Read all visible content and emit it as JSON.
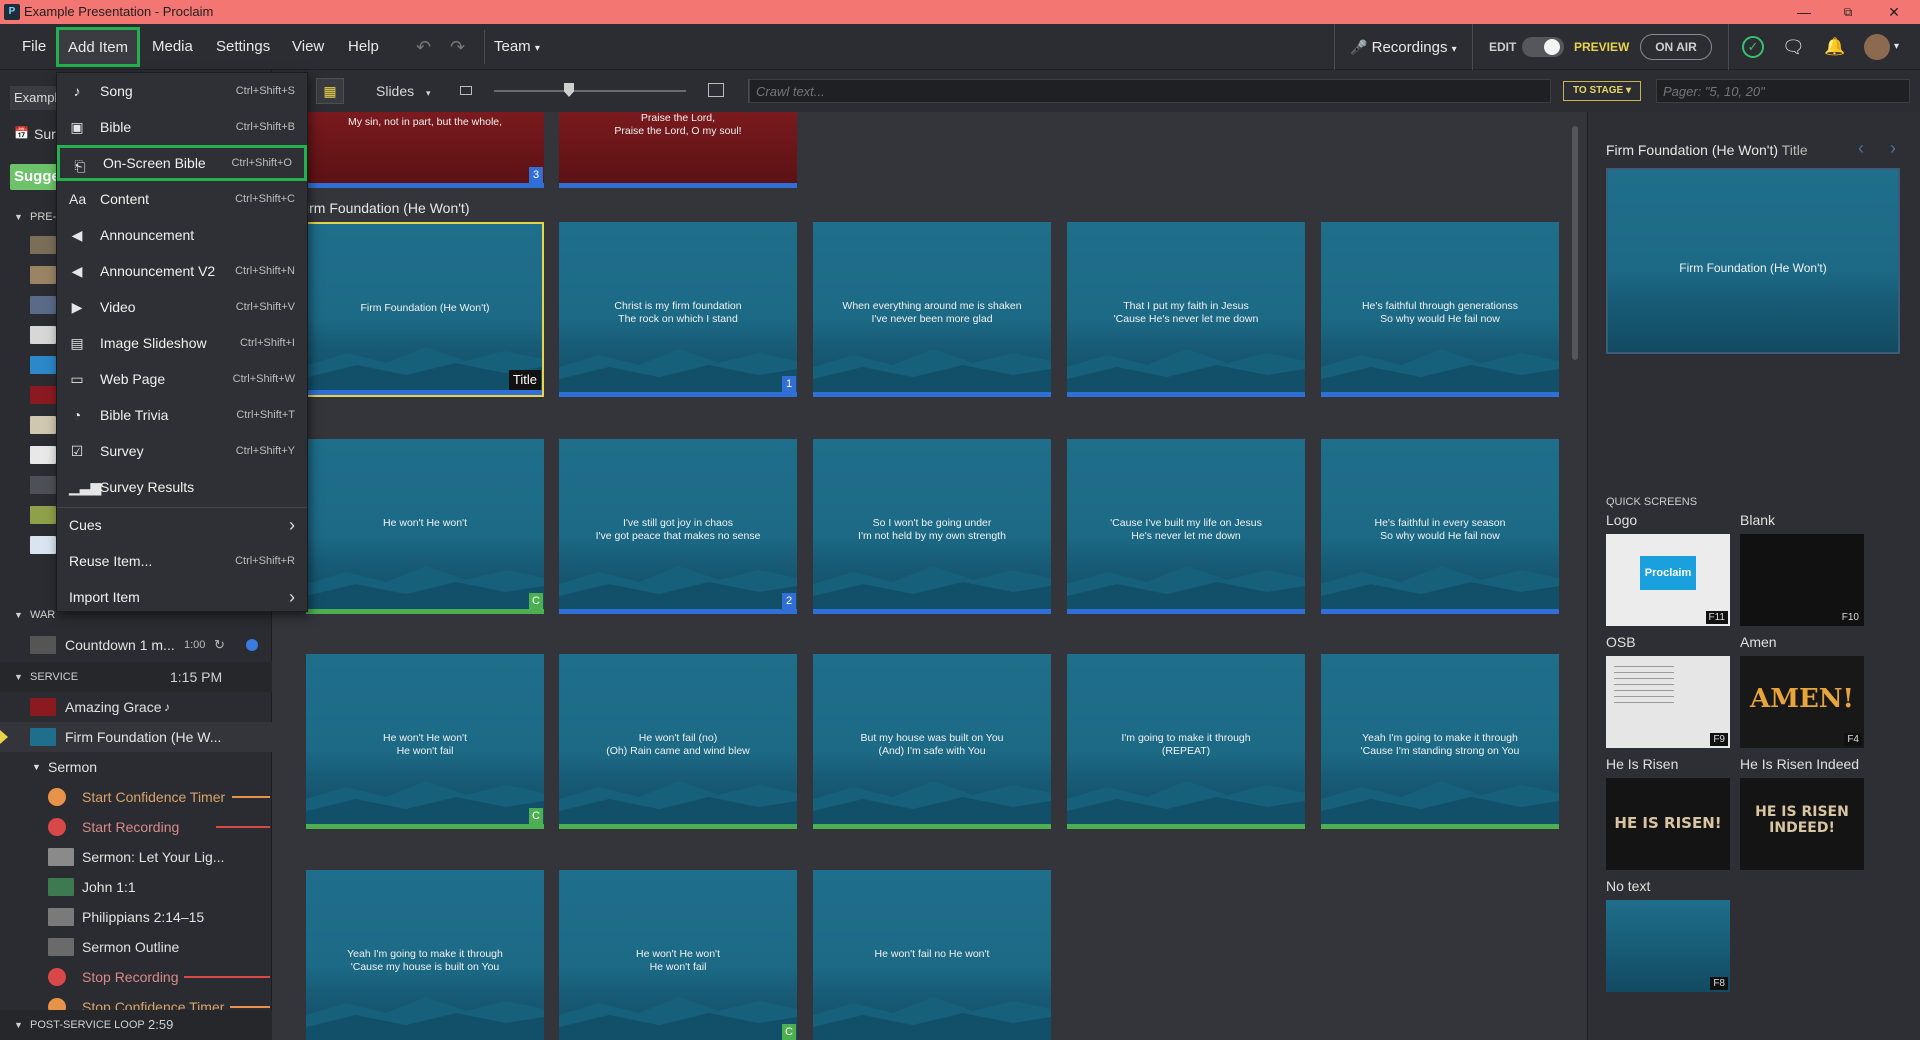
{
  "window": {
    "title": "Example Presentation - Proclaim",
    "app_icon": "proclaim-icon"
  },
  "menubar": {
    "items": [
      "File",
      "Add Item",
      "Media",
      "Settings",
      "View",
      "Help"
    ],
    "team": "Team",
    "recordings": "Recordings",
    "edit": "EDIT",
    "preview": "PREVIEW",
    "on_air": "ON AIR"
  },
  "dropdown": {
    "items": [
      {
        "label": "Song",
        "shortcut": "Ctrl+Shift+S",
        "icon": "music-note-icon"
      },
      {
        "label": "Bible",
        "shortcut": "Ctrl+Shift+B",
        "icon": "bible-icon"
      },
      {
        "label": "On-Screen Bible",
        "shortcut": "Ctrl+Shift+O",
        "icon": "onscreen-bible-icon"
      },
      {
        "label": "Content",
        "shortcut": "Ctrl+Shift+C",
        "icon": "text-content-icon"
      },
      {
        "label": "Announcement",
        "shortcut": "",
        "icon": "megaphone-icon"
      },
      {
        "label": "Announcement V2",
        "shortcut": "Ctrl+Shift+N",
        "icon": "megaphone-icon"
      },
      {
        "label": "Video",
        "shortcut": "Ctrl+Shift+V",
        "icon": "video-camera-icon"
      },
      {
        "label": "Image Slideshow",
        "shortcut": "Ctrl+Shift+I",
        "icon": "images-icon"
      },
      {
        "label": "Web Page",
        "shortcut": "Ctrl+Shift+W",
        "icon": "web-page-icon"
      },
      {
        "label": "Bible Trivia",
        "shortcut": "Ctrl+Shift+T",
        "icon": "pie-chart-icon"
      },
      {
        "label": "Survey",
        "shortcut": "Ctrl+Shift+Y",
        "icon": "checkbox-icon"
      },
      {
        "label": "Survey Results",
        "shortcut": "",
        "icon": "bar-chart-icon"
      },
      {
        "label": "Cues",
        "shortcut": "",
        "icon": ""
      },
      {
        "label": "Reuse Item...",
        "shortcut": "Ctrl+Shift+R",
        "icon": ""
      },
      {
        "label": "Import Item",
        "shortcut": "",
        "icon": ""
      }
    ]
  },
  "toolbar": {
    "slides": "Slides",
    "crawl_placeholder": "Crawl text...",
    "to_stage": "TO STAGE",
    "pager_placeholder": "Pager: \"5, 10, 20\""
  },
  "sidebar": {
    "partial_tab": "Exampl",
    "partial_sun": "Sur",
    "partial_suggest": "Sugge",
    "sections": {
      "pre": "PRE-",
      "war": "WAR",
      "service": "SERVICE",
      "service_time": "1:15 PM",
      "post": "POST-SERVICE LOOP",
      "post_time": "2:59"
    },
    "countdown": {
      "label": "Countdown 1 m...",
      "time": "1:00"
    },
    "service_items": [
      {
        "label": "Amazing Grace"
      },
      {
        "label": "Firm Foundation (He W..."
      },
      {
        "label": "Sermon"
      },
      {
        "label": "Start Confidence Timer"
      },
      {
        "label": "Start Recording"
      },
      {
        "label": "Sermon: Let Your Lig..."
      },
      {
        "label": "John 1:1"
      },
      {
        "label": "Philippians 2:14–15"
      },
      {
        "label": "Sermon Outline"
      },
      {
        "label": "Stop Recording"
      },
      {
        "label": "Stop Confidence Timer"
      }
    ]
  },
  "slides": {
    "section_title": "irm Foundation (He Won't)",
    "top_red": [
      {
        "text": "My sin, not in part, but the whole,",
        "badge": "3"
      },
      {
        "text": "Praise the Lord,\nPraise the Lord, O my soul!",
        "badge": ""
      }
    ],
    "rows": [
      [
        {
          "text": "Firm Foundation (He Won't)",
          "badge": "Title",
          "bar": "blue"
        },
        {
          "text": "Christ is my firm foundation\nThe rock on which I stand",
          "badge": "1",
          "bar": "blue"
        },
        {
          "text": "When everything around me is shaken\nI've never been more glad",
          "badge": "",
          "bar": "blue"
        },
        {
          "text": "That I put my faith in Jesus\n'Cause He's never let me down",
          "badge": "",
          "bar": "blue"
        },
        {
          "text": "He's faithful through generationss\nSo why would He fail now",
          "badge": "",
          "bar": "blue"
        }
      ],
      [
        {
          "text": "He won't He won't",
          "badge": "C",
          "bar": "green"
        },
        {
          "text": "I've still got joy in chaos\nI've got peace that makes no sense",
          "badge": "2",
          "bar": "blue"
        },
        {
          "text": "So I won't be going under\nI'm not held by my own strength",
          "badge": "",
          "bar": "blue"
        },
        {
          "text": "'Cause I've built my life on Jesus\nHe's never let me down",
          "badge": "",
          "bar": "blue"
        },
        {
          "text": "He's faithful in every season\nSo why would He fail now",
          "badge": "",
          "bar": "blue"
        }
      ],
      [
        {
          "text": "He won't He won't\nHe won't fail",
          "badge": "C",
          "bar": "green"
        },
        {
          "text": "He won't fail (no)\n(Oh) Rain came and wind blew",
          "badge": "",
          "bar": "green"
        },
        {
          "text": "But my house was built on You\n(And) I'm safe with You",
          "badge": "",
          "bar": "green"
        },
        {
          "text": "I'm going to make it through\n(REPEAT)",
          "badge": "",
          "bar": "green"
        },
        {
          "text": "Yeah I'm going to make it through\n'Cause I'm standing strong on You",
          "badge": "",
          "bar": "green"
        }
      ],
      [
        {
          "text": "Yeah I'm going to make it through\n'Cause my house is built on You",
          "badge": "",
          "bar": "none"
        },
        {
          "text": "He won't He won't\nHe won't fail",
          "badge": "C",
          "bar": "none"
        },
        {
          "text": "He won't fail no He won't",
          "badge": "",
          "bar": "none"
        }
      ]
    ]
  },
  "preview": {
    "title": "Firm Foundation (He Won't)",
    "subtitle": "Title",
    "slide_text": "Firm Foundation (He Won't)"
  },
  "quick_screens": {
    "heading": "QUICK SCREENS",
    "items": [
      {
        "label": "Logo",
        "key": "F11",
        "content": "Proclaim"
      },
      {
        "label": "Blank",
        "key": "F10",
        "content": ""
      },
      {
        "label": "OSB",
        "key": "F9",
        "content": ""
      },
      {
        "label": "Amen",
        "key": "F4",
        "content": "AMEN!"
      },
      {
        "label": "He Is Risen",
        "key": "",
        "content": "HE IS RISEN!"
      },
      {
        "label": "He Is Risen Indeed",
        "key": "",
        "content": "HE IS RISEN\nINDEED!"
      },
      {
        "label": "No text",
        "key": "F8",
        "content": ""
      }
    ]
  },
  "colors": {
    "accent_green": "#22b14c",
    "bar_blue": "#2f6fd6",
    "bar_green": "#4caf50",
    "titlebar": "#f47672"
  }
}
